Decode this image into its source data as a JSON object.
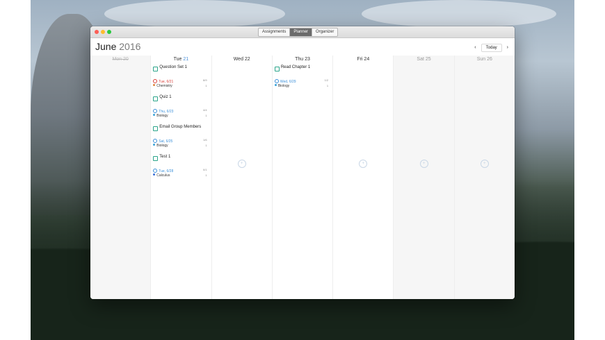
{
  "window": {
    "tabs": [
      {
        "label": "Assignments",
        "active": false
      },
      {
        "label": "Planner",
        "active": true
      },
      {
        "label": "Organizer",
        "active": false
      }
    ]
  },
  "header": {
    "month": "June",
    "year": "2016",
    "today_label": "Today",
    "prev_glyph": "‹",
    "next_glyph": "›"
  },
  "days": [
    {
      "label": "Mon 20",
      "past": true,
      "tasks": []
    },
    {
      "label_day": "Tue",
      "label_num": "21",
      "today": true,
      "tasks": [
        {
          "name": "Question Set 1",
          "due": "Tue, 6/21",
          "due_color": "red",
          "subject": "Chemistry",
          "subject_color": "#e0843a",
          "meta1": "8/9",
          "meta2": "1"
        },
        {
          "name": "Quiz 1",
          "due": "Thu, 6/23",
          "due_color": "blue",
          "subject": "Biology",
          "subject_color": "#3aa3d9",
          "meta1": "4/4",
          "meta2": "1"
        },
        {
          "name": "Email Group Members",
          "due": "Sat, 6/25",
          "due_color": "blue",
          "subject": "Biology",
          "subject_color": "#3aa3d9",
          "meta1": "1/6",
          "meta2": "1"
        },
        {
          "name": "Test 1",
          "due": "Tue, 6/28",
          "due_color": "blue",
          "subject": "Calculus",
          "subject_color": "#3a6fd9",
          "meta1": "0/1",
          "meta2": "1"
        }
      ]
    },
    {
      "label": "Wed 22",
      "tasks": []
    },
    {
      "label": "Thu 23",
      "tasks": [
        {
          "name": "Read Chapter 1",
          "due": "Wed, 6/29",
          "due_color": "blue",
          "subject": "Biology",
          "subject_color": "#3aa3d9",
          "meta1": "1/2",
          "meta2": "1"
        }
      ]
    },
    {
      "label": "Fri 24",
      "tasks": []
    },
    {
      "label": "Sat 25",
      "weekend": true,
      "tasks": []
    },
    {
      "label": "Sun 26",
      "weekend": true,
      "tasks": []
    }
  ],
  "add_glyph": "+"
}
